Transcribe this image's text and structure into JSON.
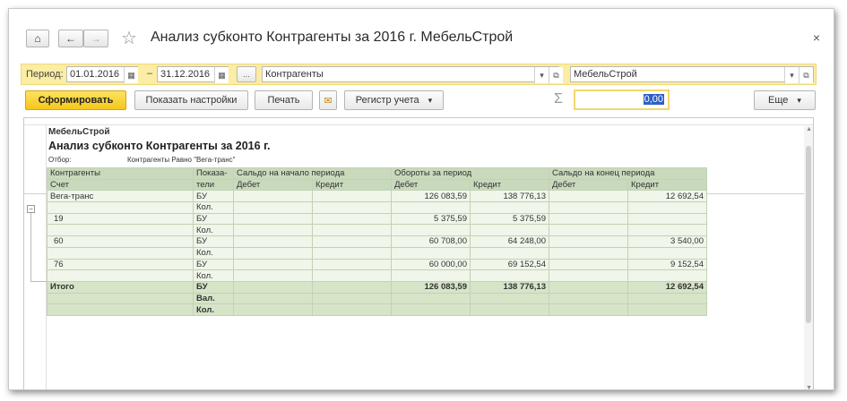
{
  "window": {
    "title": "Анализ субконто Контрагенты за 2016 г. МебельСтрой",
    "home_icon": "home-icon",
    "back_icon": "arrow-left-icon",
    "forward_icon": "arrow-right-icon",
    "favorite_icon": "star-icon",
    "close_icon": "close-icon",
    "home_glyph": "⌂",
    "back_glyph": "←",
    "forward_glyph": "→",
    "star_glyph": "☆",
    "close_glyph": "×"
  },
  "params": {
    "period_label": "Период:",
    "date_from": "01.01.2016",
    "date_to": "31.12.2016",
    "dash": "–",
    "more_label": "...",
    "subconto_type": "Контрагенты",
    "organization": "МебельСтрой",
    "calendar_icon": "calendar-icon",
    "dropdown_icon": "chevron-down-icon",
    "open_icon": "open-form-icon",
    "calendar_glyph": "▦",
    "dropdown_glyph": "▾",
    "open_glyph": "⧉"
  },
  "toolbar": {
    "generate_label": "Сформировать",
    "settings_label": "Показать настройки",
    "print_label": "Печать",
    "mail_icon": "envelope-icon",
    "mail_glyph": "✉",
    "register_label": "Регистр учета",
    "register_caret": "▾",
    "sigma_icon": "sigma-icon",
    "sigma_glyph": "Σ",
    "sum_value": "0,00",
    "more_label": "Еще",
    "more_caret": "▾"
  },
  "report": {
    "organization": "МебельСтрой",
    "title": "Анализ субконто Контрагенты за 2016 г.",
    "filter_label": "Отбор:",
    "filter_value": "Контрагенты Равно \"Вега-транс\"",
    "group_toggle": "−",
    "headers": {
      "kontragenty": "Контрагенты",
      "pokazateli": "Показа-",
      "pokazateli2": "тели",
      "schet": "Счет",
      "saldo_start": "Сальдо на начало периода",
      "oboroty": "Обороты за период",
      "saldo_end": "Сальдо на конец периода",
      "debet": "Дебет",
      "kredit": "Кредит"
    },
    "rows": [
      {
        "name": "Вега-транс",
        "ind": "БУ",
        "sd": "",
        "sk": "",
        "od": "126 083,59",
        "ok": "138 776,13",
        "ed": "",
        "ek": "12 692,54"
      },
      {
        "name": "",
        "ind": "Кол.",
        "sd": "",
        "sk": "",
        "od": "",
        "ok": "",
        "ed": "",
        "ek": ""
      },
      {
        "name": "19",
        "ind": "БУ",
        "sd": "",
        "sk": "",
        "od": "5 375,59",
        "ok": "5 375,59",
        "ed": "",
        "ek": ""
      },
      {
        "name": "",
        "ind": "Кол.",
        "sd": "",
        "sk": "",
        "od": "",
        "ok": "",
        "ed": "",
        "ek": ""
      },
      {
        "name": "60",
        "ind": "БУ",
        "sd": "",
        "sk": "",
        "od": "60 708,00",
        "ok": "64 248,00",
        "ed": "",
        "ek": "3 540,00"
      },
      {
        "name": "",
        "ind": "Кол.",
        "sd": "",
        "sk": "",
        "od": "",
        "ok": "",
        "ed": "",
        "ek": ""
      },
      {
        "name": "76",
        "ind": "БУ",
        "sd": "",
        "sk": "",
        "od": "60 000,00",
        "ok": "69 152,54",
        "ed": "",
        "ek": "9 152,54"
      },
      {
        "name": "",
        "ind": "Кол.",
        "sd": "",
        "sk": "",
        "od": "",
        "ok": "",
        "ed": "",
        "ek": ""
      }
    ],
    "total": [
      {
        "name": "Итого",
        "ind": "БУ",
        "sd": "",
        "sk": "",
        "od": "126 083,59",
        "ok": "138 776,13",
        "ed": "",
        "ek": "12 692,54"
      },
      {
        "name": "",
        "ind": "Вал.",
        "sd": "",
        "sk": "",
        "od": "",
        "ok": "",
        "ed": "",
        "ek": ""
      },
      {
        "name": "",
        "ind": "Кол.",
        "sd": "",
        "sk": "",
        "od": "",
        "ok": "",
        "ed": "",
        "ek": ""
      }
    ]
  },
  "scrollbar": {
    "up_glyph": "▲",
    "down_glyph": "▼"
  }
}
